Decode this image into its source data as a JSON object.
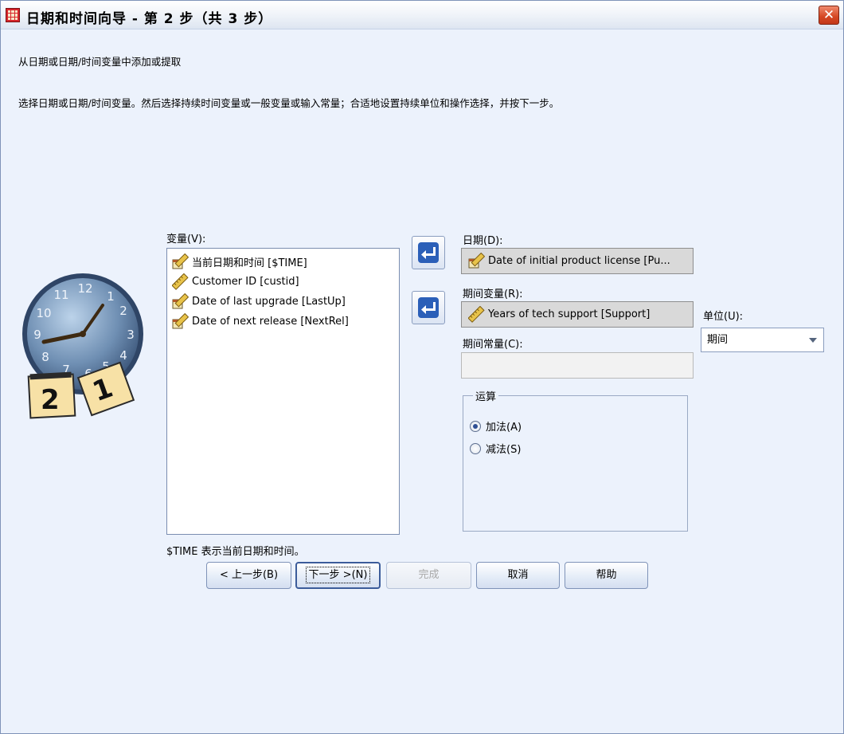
{
  "window": {
    "title": "日期和时间向导 - 第 2 步（共 3 步）",
    "close_symbol": "✕"
  },
  "header": {
    "subtitle": "从日期或日期/时间变量中添加或提取",
    "instructions": "选择日期或日期/时间变量。然后选择持续时间变量或一般变量或输入常量；合适地设置持续单位和操作选择，并按下一步。"
  },
  "variables": {
    "label": "变量(V):",
    "items": [
      {
        "label": "当前日期和时间 [$TIME]",
        "icon": "date-ruler-icon"
      },
      {
        "label": "Customer ID [custid]",
        "icon": "ruler-icon"
      },
      {
        "label": "Date of last upgrade [LastUp]",
        "icon": "date-ruler-icon"
      },
      {
        "label": "Date of next release [NextRel]",
        "icon": "date-ruler-icon"
      }
    ],
    "footnote": "$TIME 表示当前日期和时间。"
  },
  "date_field": {
    "label": "日期(D):",
    "value": "Date of initial product license [Pu...",
    "icon": "date-ruler-icon"
  },
  "duration_variable": {
    "label": "期间变量(R):",
    "value": "Years of tech support [Support]",
    "icon": "ruler-icon"
  },
  "duration_constant": {
    "label": "期间常量(C):",
    "value": ""
  },
  "unit": {
    "label": "单位(U):",
    "selected": "期间"
  },
  "operation": {
    "legend": "运算",
    "options": [
      {
        "label": "加法(A)",
        "checked": true
      },
      {
        "label": "减法(S)",
        "checked": false
      }
    ]
  },
  "buttons": {
    "back": "< 上一步(B)",
    "next": "下一步 >(N)",
    "finish": "完成",
    "cancel": "取消",
    "help": "帮助"
  },
  "illustration": {
    "clock_numbers": [
      "12",
      "11",
      "1",
      "10",
      "2",
      "9",
      "3",
      "8",
      "4",
      "7",
      "6",
      "5"
    ],
    "calendar_pages": [
      "2",
      "1"
    ]
  },
  "colors": {
    "dialog_bg": "#ecf2fc",
    "arrow_blue": "#2b5fb8",
    "close_red": "#d44622"
  }
}
